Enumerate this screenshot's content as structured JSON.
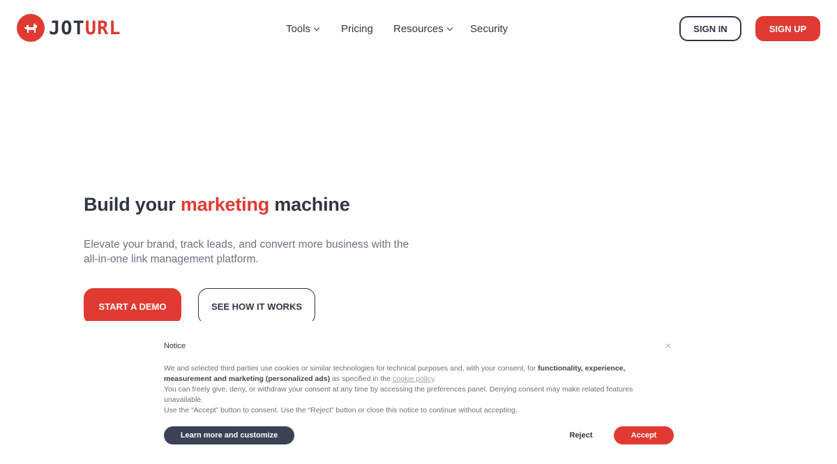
{
  "header": {
    "logo": {
      "part1": "JOT",
      "part2": "URL",
      "icon": "dog-icon"
    },
    "nav": [
      {
        "label": "Tools",
        "has_dropdown": true
      },
      {
        "label": "Pricing",
        "has_dropdown": false
      },
      {
        "label": "Resources",
        "has_dropdown": true
      },
      {
        "label": "Security",
        "has_dropdown": false
      }
    ],
    "sign_in": "SIGN IN",
    "sign_up": "SIGN UP"
  },
  "hero": {
    "title_before": "Build your ",
    "title_accent": "marketing",
    "title_after": " machine",
    "subtitle": "Elevate your brand, track leads, and convert more business with the all-in-one link management platform.",
    "cta_primary": "START A DEMO",
    "cta_secondary": "SEE HOW IT WORKS"
  },
  "cookie_notice": {
    "title": "Notice",
    "close_icon": "close-icon",
    "p1_before": "We and selected third parties use cookies or similar technologies for technical purposes and, with your consent, for ",
    "p1_bold": "functionality, experience, measurement and marketing (personalized ads)",
    "p1_mid": " as specified in the ",
    "p1_link": "cookie policy",
    "p1_end": ".",
    "p2": "You can freely give, deny, or withdraw your consent at any time by accessing the preferences panel. Denying consent may make related features unavailable.",
    "p3": "Use the “Accept” button to consent. Use the “Reject” button or close this notice to continue without accepting.",
    "learn_more": "Learn more and customize",
    "reject": "Reject",
    "accept": "Accept"
  },
  "colors": {
    "brand_red": "#e03a33",
    "dark": "#2f3542",
    "muted": "#6b7280"
  }
}
